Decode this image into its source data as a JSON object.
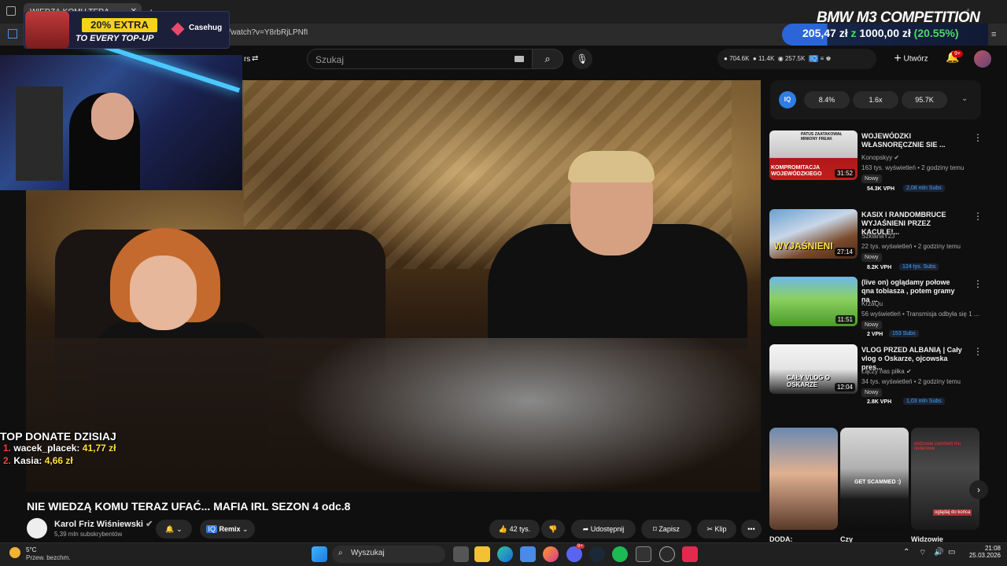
{
  "browser": {
    "tab_title": "WIEDZĄ KOMU TERA",
    "url": "a/watch?v=Y8rbRjLPNfI"
  },
  "header": {
    "search_placeholder": "Szukaj",
    "stats": [
      "704.6K",
      "11.4K",
      "257.5K"
    ],
    "create_label": "Utwórz",
    "notif_count": "9+",
    "filters_label": "rs"
  },
  "overlay": {
    "promo_extra": "20% EXTRA",
    "promo_sub": "TO EVERY TOP-UP",
    "promo_brand": "Casehug",
    "goal_title": "BMW M3 COMPETITION",
    "goal_current": "205,47 zł",
    "goal_sep": "z",
    "goal_target": "1000,00 zł",
    "goal_pct": "(20.55%)",
    "donate_title": "TOP DONATE DZISIAJ",
    "donations": [
      {
        "rank": "1.",
        "name": "wacek_placek:",
        "amount": "41,77 zł"
      },
      {
        "rank": "2.",
        "name": "Kasia:",
        "amount": "4,66 zł"
      }
    ]
  },
  "video": {
    "title": "NIE WIEDZĄ KOMU TERAZ UFAĆ... MAFIA IRL SEZON 4 odc.8",
    "channel_name": "Karol Friz Wiśniewski",
    "channel_subs": "5,39 mln subskrybentów",
    "remix_label": "Remix",
    "likes": "42 tys.",
    "share_label": "Udostępnij",
    "save_label": "Zapisz",
    "clip_label": "Klip"
  },
  "iq": {
    "logo": "IQ",
    "chips": [
      "8.4%",
      "1.6x",
      "95.7K"
    ]
  },
  "recommendations": [
    {
      "title": "WOJEWÓDZKI WŁASNORĘCZNIE SIE ...",
      "channel": "Konopskyy",
      "meta": "163 tys. wyświetleń • 2 godziny temu",
      "badge": "Nowy",
      "vph": "54.3K VPH",
      "subs": "2,08 mln Subs",
      "duration": "31:52",
      "thumb_text": "KOMPROMITACJA WOJEWÓDZKIEGO",
      "thumb_top": "PATUS ZAATAKOWAŁ MINIONY FREAK"
    },
    {
      "title": "KASIX I RANDOMBRUCE WYJAŚNIENI PRZEZ KACULE!...",
      "channel": "SzklanaY2J",
      "meta": "22 tys. wyświetleń • 2 godziny temu",
      "badge": "Nowy",
      "vph": "8.2K VPH",
      "subs": "124 tys. Subs",
      "duration": "27:14",
      "thumb_text": "WYJAŚNIENI"
    },
    {
      "title": "(live on) oglądamy połowe qna tobiasza , potem gramy na ...",
      "channel": "KrzaQu",
      "meta": "56 wyświetleń • Transmisja odbyła się 1 ...",
      "badge": "Nowy",
      "vph": "2 VPH",
      "subs": "153 Subs",
      "duration": "11:51",
      "thumb_text": ""
    },
    {
      "title": "VLOG PRZED ALBANIĄ | Cały vlog o Oskarze, ojcowska pres...",
      "channel": "Łączy nas piłka",
      "meta": "34 tys. wyświetleń • 2 godziny temu",
      "badge": "Nowy",
      "vph": "2.8K VPH",
      "subs": "1,03 mln Subs",
      "duration": "12:04",
      "thumb_text": "CAŁY VLOG O OSKARZE"
    }
  ],
  "shorts": [
    {
      "title": "DODA:",
      "overlay": ""
    },
    {
      "title": "Czy",
      "overlay": "GET SCAMMED :)"
    },
    {
      "title": "Widzowie",
      "overlay": "widzowie zamówili mu tinderowe",
      "overlay2": "oglądaj do końca"
    }
  ],
  "taskbar": {
    "temp": "5°C",
    "weather": "Przew. bezchm.",
    "search": "Wyszukaj",
    "time": "21:08",
    "date": "25.03.2026",
    "badge": "9+"
  }
}
